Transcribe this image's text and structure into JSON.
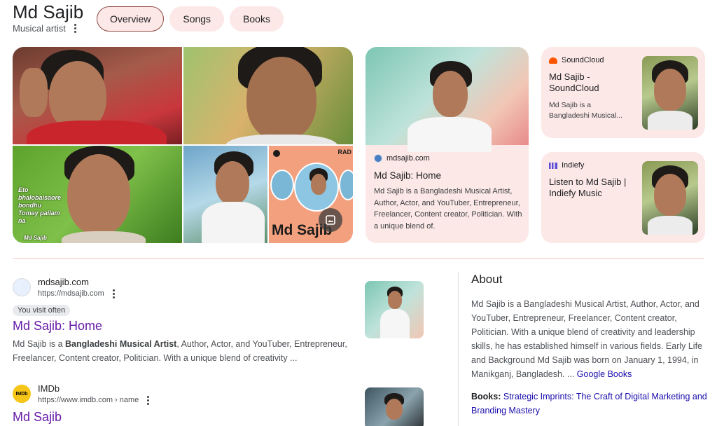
{
  "header": {
    "name": "Md Sajib",
    "subtitle": "Musical artist",
    "tabs": [
      {
        "label": "Overview",
        "active": true
      },
      {
        "label": "Songs",
        "active": false
      },
      {
        "label": "Books",
        "active": false
      }
    ]
  },
  "mosaic": {
    "overlay_text": "Eto bhalobaisaore bondhu Tomay pailam na",
    "watermark": "Md Sajib",
    "tile5_title": "Md Sajib",
    "tile5_corner": "RAD"
  },
  "site_card": {
    "source": "mdsajib.com",
    "title": "Md Sajib: Home",
    "description": "Md Sajib is a Bangladeshi Musical Artist, Author, Actor, and YouTuber, Entrepreneur, Freelancer, Content creator, Politician. With a unique blend of."
  },
  "mini_cards": [
    {
      "source": "SoundCloud",
      "title": "Md Sajib - SoundCloud",
      "description": "Md Sajib is a Bangladeshi Musical..."
    },
    {
      "source": "Indiefy",
      "title": "Listen to Md Sajib | Indiefy Music",
      "description": ""
    }
  ],
  "results": [
    {
      "site": "mdsajib.com",
      "url": "https://mdsajib.com",
      "visit_chip": "You visit often",
      "title": "Md Sajib: Home",
      "snippet_pre": "Md Sajib is a ",
      "snippet_bold": "Bangladeshi Musical Artist",
      "snippet_post": ", Author, Actor, and YouTuber, Entrepreneur, Freelancer, Content creator, Politician. With a unique blend of creativity ..."
    },
    {
      "site": "IMDb",
      "url": "https://www.imdb.com › name",
      "title": "Md Sajib",
      "favicon_text": "IMDb"
    }
  ],
  "about": {
    "heading": "About",
    "text": "Md Sajib is a Bangladeshi Musical Artist, Author, Actor, and YouTuber, Entrepreneur, Freelancer, Content creator, Politician. With a unique blend of creativity and leadership skills, he has established himself in various fields. Early Life and Background Md Sajib was born on January 1, 1994, in Manikganj, Bangladesh. ... ",
    "source_link": "Google Books",
    "books_label": "Books:",
    "books_value": "Strategic Imprints: The Craft of Digital Marketing and Branding Mastery"
  },
  "colors": {
    "chip_bg": "#fce8e6",
    "link_visited": "#681da8",
    "link": "#1a0dab"
  }
}
